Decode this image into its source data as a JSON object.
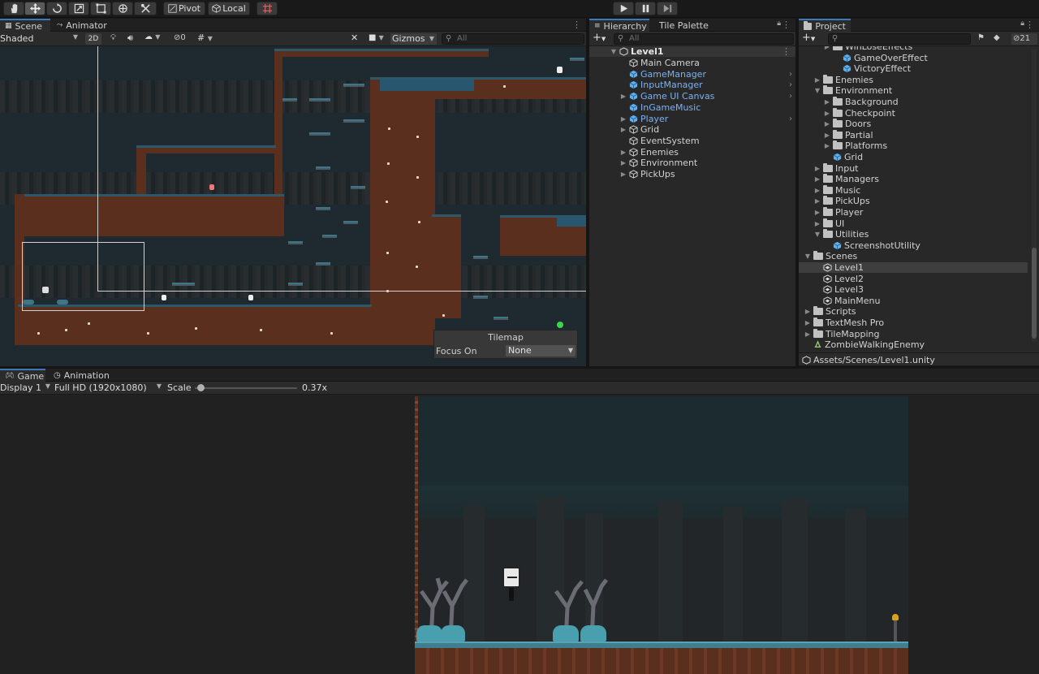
{
  "toolbar": {
    "pivot_label": "Pivot",
    "local_label": "Local",
    "tools": [
      "hand-tool",
      "move-tool",
      "rotate-tool",
      "scale-tool",
      "rect-tool",
      "transform-tool",
      "custom-tool"
    ]
  },
  "scene_panel": {
    "tabs": [
      "Scene",
      "Animator"
    ],
    "shading_mode": "Shaded",
    "btn_2d": "2D",
    "hidden_count": "0",
    "gizmos_label": "Gizmos",
    "search_placeholder": "All",
    "tilemap_overlay": {
      "title": "Tilemap",
      "focus_label": "Focus On",
      "focus_value": "None"
    }
  },
  "hierarchy_panel": {
    "tabs": [
      "Hierarchy",
      "Tile Palette"
    ],
    "search_placeholder": "All",
    "scene_name": "Level1",
    "items": [
      {
        "label": "Main Camera",
        "prefab": false,
        "expandable": false
      },
      {
        "label": "GameManager",
        "prefab": true,
        "expandable": false
      },
      {
        "label": "InputManager",
        "prefab": true,
        "expandable": false
      },
      {
        "label": "Game UI Canvas",
        "prefab": true,
        "expandable": true
      },
      {
        "label": "InGameMusic",
        "prefab": true,
        "expandable": false
      },
      {
        "label": "Player",
        "prefab": true,
        "expandable": true
      },
      {
        "label": "Grid",
        "prefab": false,
        "expandable": true
      },
      {
        "label": "EventSystem",
        "prefab": false,
        "expandable": false
      },
      {
        "label": "Enemies",
        "prefab": false,
        "expandable": true
      },
      {
        "label": "Environment",
        "prefab": false,
        "expandable": true
      },
      {
        "label": "PickUps",
        "prefab": false,
        "expandable": true
      }
    ]
  },
  "project_panel": {
    "tab": "Project",
    "hidden_count": "21",
    "tree": [
      {
        "label": "WinLoseEffects",
        "type": "folder",
        "depth": 3
      },
      {
        "label": "GameOverEffect",
        "type": "prefab",
        "depth": 4
      },
      {
        "label": "VictoryEffect",
        "type": "prefab",
        "depth": 4
      },
      {
        "label": "Enemies",
        "type": "folder",
        "depth": 2
      },
      {
        "label": "Environment",
        "type": "folder-open",
        "depth": 2
      },
      {
        "label": "Background",
        "type": "folder",
        "depth": 3
      },
      {
        "label": "Checkpoint",
        "type": "folder",
        "depth": 3
      },
      {
        "label": "Doors",
        "type": "folder",
        "depth": 3
      },
      {
        "label": "Partial",
        "type": "folder",
        "depth": 3
      },
      {
        "label": "Platforms",
        "type": "folder",
        "depth": 3
      },
      {
        "label": "Grid",
        "type": "prefab",
        "depth": 3
      },
      {
        "label": "Input",
        "type": "folder",
        "depth": 2
      },
      {
        "label": "Managers",
        "type": "folder",
        "depth": 2
      },
      {
        "label": "Music",
        "type": "folder",
        "depth": 2
      },
      {
        "label": "PickUps",
        "type": "folder",
        "depth": 2
      },
      {
        "label": "Player",
        "type": "folder",
        "depth": 2
      },
      {
        "label": "UI",
        "type": "folder",
        "depth": 2
      },
      {
        "label": "Utilities",
        "type": "folder-open",
        "depth": 2
      },
      {
        "label": "ScreenshotUtility",
        "type": "prefab",
        "depth": 3
      },
      {
        "label": "Scenes",
        "type": "folder-open",
        "depth": 1
      },
      {
        "label": "Level1",
        "type": "scene",
        "depth": 2,
        "selected": true
      },
      {
        "label": "Level2",
        "type": "scene",
        "depth": 2
      },
      {
        "label": "Level3",
        "type": "scene",
        "depth": 2
      },
      {
        "label": "MainMenu",
        "type": "scene",
        "depth": 2
      },
      {
        "label": "Scripts",
        "type": "folder",
        "depth": 1
      },
      {
        "label": "TextMesh Pro",
        "type": "folder",
        "depth": 1
      },
      {
        "label": "TileMapping",
        "type": "folder",
        "depth": 1
      },
      {
        "label": "ZombieWalkingEnemy",
        "type": "asset",
        "depth": 1
      }
    ],
    "footer_path": "Assets/Scenes/Level1.unity"
  },
  "game_panel": {
    "tabs": [
      "Game",
      "Animation"
    ],
    "display": "Display 1",
    "resolution": "Full HD (1920x1080)",
    "scale_label": "Scale",
    "scale_value": "0.37x",
    "scale_fraction": 0.02
  },
  "colors": {
    "accent": "#3a79bb",
    "prefab_text": "#7cb1f0",
    "dirt": "#5b2f1e",
    "grass": "#2e5868"
  }
}
